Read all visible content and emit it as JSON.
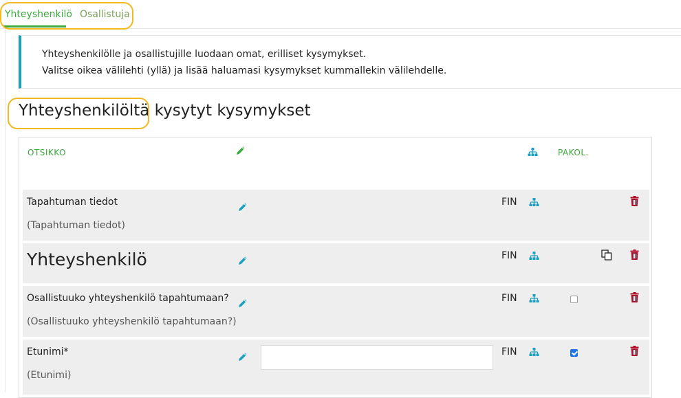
{
  "tabs": [
    {
      "label": "Yhteyshenkilö",
      "active": true
    },
    {
      "label": "Osallistuja",
      "active": false
    }
  ],
  "info": {
    "line1": "Yhteyshenkilölle ja osallistujille luodaan omat, erilliset kysymykset.",
    "line2": "Valitse oikea välilehti (yllä) ja lisää haluamasi kysymykset kummallekin välilehdelle."
  },
  "section_title": "Yhteyshenkilöltä kysytyt kysymykset",
  "table": {
    "headers": {
      "title": "OTSIKKO",
      "required": "PAKOL."
    },
    "rows": [
      {
        "title": "Tapahtuman tiedot",
        "subtitle": "(Tapahtuman tiedot)",
        "language": "FIN",
        "required": null
      },
      {
        "title": "Yhteyshenkilö",
        "subtitle": "",
        "language": "FIN",
        "required": null
      },
      {
        "title": "Osallistuuko yhteyshenkilö tapahtumaan?",
        "subtitle": "(Osallistuuko yhteyshenkilö tapahtumaan?)",
        "language": "FIN",
        "required": false
      },
      {
        "title": "Etunimi*",
        "subtitle": "(Etunimi)",
        "language": "FIN",
        "required": true,
        "input_value": ""
      }
    ]
  },
  "colors": {
    "accent_green": "#3aa83a",
    "info_border": "#1b9fbf",
    "tree_icon": "#1b9fbf",
    "delete_icon": "#b0102a",
    "highlight_ring": "#f2b81f"
  }
}
